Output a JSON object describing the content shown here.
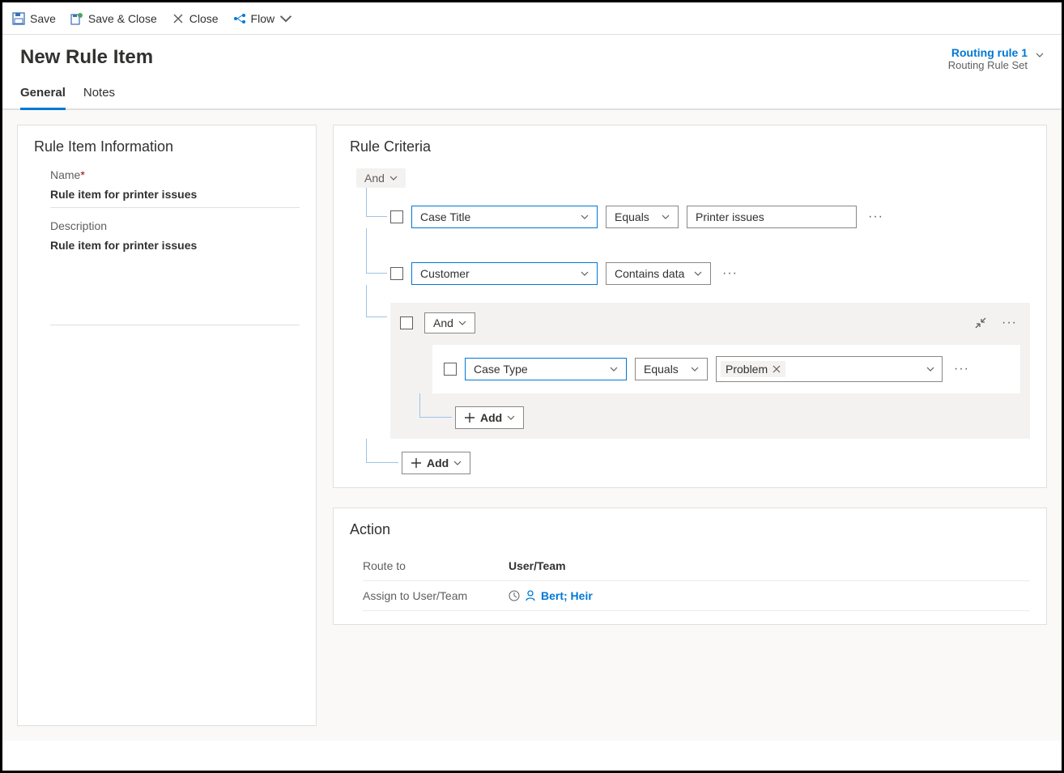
{
  "toolbar": {
    "save": "Save",
    "save_close": "Save & Close",
    "close": "Close",
    "flow": "Flow"
  },
  "header": {
    "title": "New Rule Item",
    "rule_link": "Routing rule 1",
    "rule_sub": "Routing Rule Set"
  },
  "tabs": {
    "general": "General",
    "notes": "Notes"
  },
  "info": {
    "section": "Rule Item Information",
    "name_label": "Name",
    "name_value": "Rule item for printer issues",
    "desc_label": "Description",
    "desc_value": "Rule item for printer issues"
  },
  "criteria": {
    "section": "Rule Criteria",
    "top_and": "And",
    "rows": [
      {
        "field": "Case Title",
        "op": "Equals",
        "value": "Printer issues"
      },
      {
        "field": "Customer",
        "op": "Contains data"
      }
    ],
    "nested": {
      "and": "And",
      "row": {
        "field": "Case Type",
        "op": "Equals",
        "tag": "Problem"
      },
      "add": "Add"
    },
    "add": "Add"
  },
  "action": {
    "section": "Action",
    "route_label": "Route to",
    "route_value": "User/Team",
    "assign_label": "Assign to User/Team",
    "assign_value": "Bert; Heir"
  }
}
